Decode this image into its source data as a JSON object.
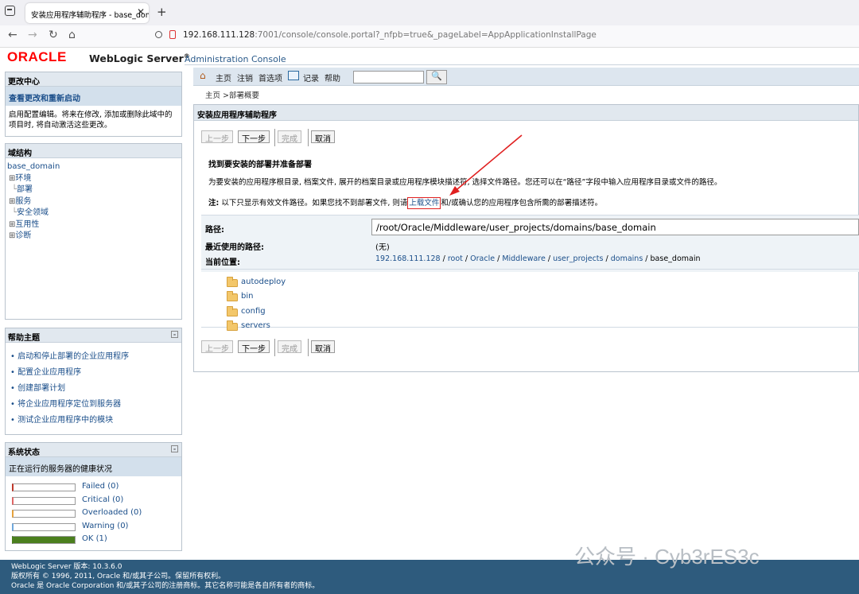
{
  "browser": {
    "tab_title": "安装应用程序辅助程序 - base_dom",
    "url_host": "192.168.111.128",
    "url_rest": ":7001/console/console.portal?_nfpb=true&_pageLabel=AppApplicationInstallPage"
  },
  "header": {
    "oracle": "ORACLE",
    "product": "WebLogic Server",
    "reg": "®",
    "console": "Administration Console"
  },
  "change_center": {
    "title": "更改中心",
    "link": "查看更改和重新启动",
    "text": "启用配置编辑。将来在修改, 添加或删除此域中的项目时, 将自动激活这些更改。"
  },
  "domain_structure": {
    "title": "域结构",
    "root": "base_domain",
    "items": [
      {
        "prefix": "⊞",
        "label": "环境"
      },
      {
        "prefix": "",
        "label": "部署"
      },
      {
        "prefix": "⊞",
        "label": "服务"
      },
      {
        "prefix": "",
        "label": "安全领域"
      },
      {
        "prefix": "⊞",
        "label": "互用性"
      },
      {
        "prefix": "⊞",
        "label": "诊断"
      }
    ]
  },
  "help": {
    "title": "帮助主题",
    "minus": "⊟",
    "items": [
      "启动和停止部署的企业应用程序",
      "配置企业应用程序",
      "创建部署计划",
      "将企业应用程序定位到服务器",
      "测试企业应用程序中的模块"
    ]
  },
  "system_status": {
    "title": "系统状态",
    "minus": "⊟",
    "subtitle": "正在运行的服务器的健康状况",
    "items": [
      {
        "label": "Failed (0)",
        "color": "#c0392b",
        "level": 0
      },
      {
        "label": "Critical (0)",
        "color": "#e06666",
        "level": 0
      },
      {
        "label": "Overloaded (0)",
        "color": "#e6a23c",
        "level": 0
      },
      {
        "label": "Warning (0)",
        "color": "#6fa8dc",
        "level": 0
      },
      {
        "label": "OK (1)",
        "color": "#4b7f1e",
        "level": 1
      }
    ]
  },
  "toolbar": {
    "home": "主页",
    "logout": "注销",
    "prefs": "首选项",
    "record": "记录",
    "help": "帮助",
    "search_value": "",
    "search_icon": "🔍"
  },
  "breadcrumb": "主页 >部署概要",
  "main": {
    "title": "安装应用程序辅助程序",
    "buttons": {
      "back": "上一步",
      "next": "下一步",
      "finish": "完成",
      "cancel": "取消"
    },
    "heading": "找到要安装的部署并准备部署",
    "desc": "为要安装的应用程序根目录, 档案文件, 展开的档案目录或应用程序模块描述符, 选择文件路径。您还可以在“路径”字段中输入应用程序目录或文件的路径。",
    "note_label": "注:",
    "note_pre": " 以下只显示有效文件路径。如果您找不到部署文件, 则请",
    "note_link": "上载文件",
    "note_post": "和/或确认您的应用程序包含所需的部署描述符。",
    "path_label": "路径:",
    "path_value": "/root/Oracle/Middleware/user_projects/domains/base_domain",
    "recent_label": "最近使用的路径:",
    "recent_value": "(无)",
    "location_label": "当前位置:",
    "location": [
      "192.168.111.128",
      "root",
      "Oracle",
      "Middleware",
      "user_projects",
      "domains",
      "base_domain"
    ],
    "sep": " / ",
    "folders": [
      "autodeploy",
      "bin",
      "config",
      "servers"
    ]
  },
  "footer": {
    "line1": "WebLogic Server 版本: 10.3.6.0",
    "line2": "版权所有 © 1996, 2011, Oracle 和/或其子公司。保留所有权利。",
    "line3": "Oracle 是 Oracle Corporation 和/或其子公司的注册商标。其它名称可能是各自所有者的商标。"
  },
  "watermark": "公众号 · Cyb3rES3c"
}
